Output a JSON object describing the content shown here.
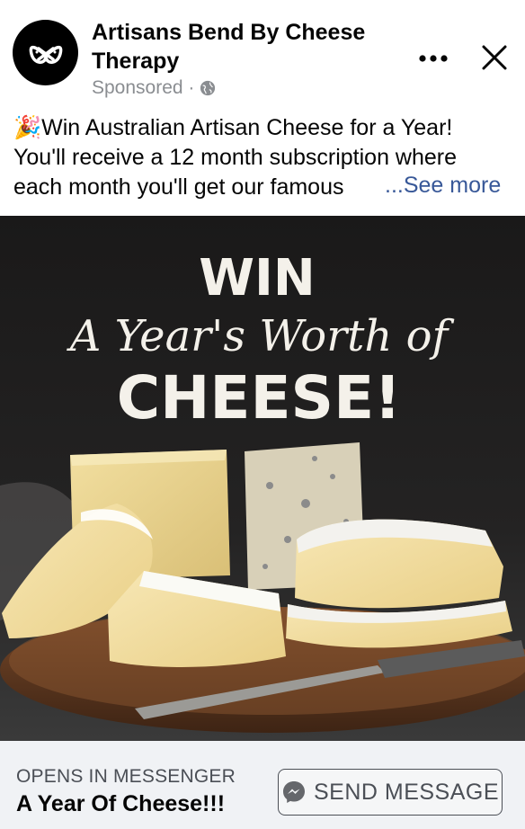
{
  "header": {
    "page_name": "Artisans Bend By Cheese Therapy",
    "sponsored": "Sponsored ·",
    "icons": {
      "avatar": "pretzel-logo",
      "privacy": "globe-icon",
      "more": "more-dots-icon",
      "close": "close-icon"
    }
  },
  "post": {
    "emoji": "🎉",
    "line1": "Win Australian Artisan Cheese for a Year!",
    "line2": "You'll receive a 12 month subscription where",
    "line3": "each month you'll get our famous",
    "see_more": "...See more"
  },
  "image": {
    "headline_top": "WIN",
    "headline_script": "A Year's Worth of",
    "headline_bottom": "CHEESE!"
  },
  "footer": {
    "opens_label": "OPENS IN MESSENGER",
    "title": "A Year Of Cheese!!!",
    "button_label": "SEND MESSAGE",
    "button_icon": "messenger-icon"
  },
  "colors": {
    "link": "#385898",
    "footer_bg": "#f0f2f5",
    "muted": "#8a8d91"
  }
}
